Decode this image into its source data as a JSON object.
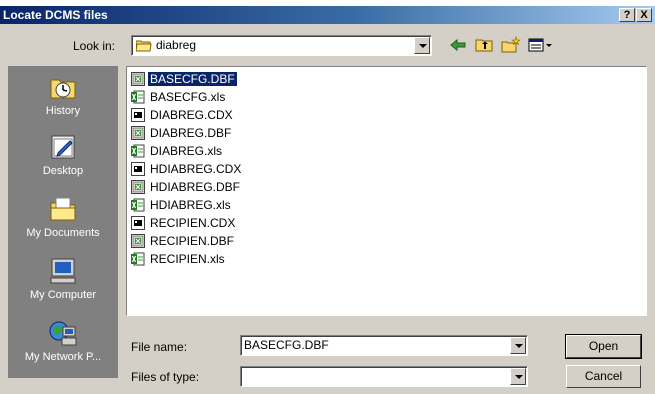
{
  "dialog": {
    "title": "Locate DCMS files",
    "help_label": "?",
    "close_label": "X"
  },
  "look_in": {
    "label": "Look in:",
    "value": "diabreg"
  },
  "places": [
    {
      "label": "History",
      "icon": "history-icon"
    },
    {
      "label": "Desktop",
      "icon": "desktop-icon"
    },
    {
      "label": "My Documents",
      "icon": "my-documents-icon"
    },
    {
      "label": "My Computer",
      "icon": "my-computer-icon"
    },
    {
      "label": "My Network P...",
      "icon": "my-network-places-icon"
    }
  ],
  "files": [
    {
      "name": "BASECFG.DBF",
      "type": "dbf",
      "selected": true
    },
    {
      "name": "BASECFG.xls",
      "type": "xls"
    },
    {
      "name": "DIABREG.CDX",
      "type": "cdx"
    },
    {
      "name": "DIABREG.DBF",
      "type": "dbf"
    },
    {
      "name": "DIABREG.xls",
      "type": "xls"
    },
    {
      "name": "HDIABREG.CDX",
      "type": "cdx"
    },
    {
      "name": "HDIABREG.DBF",
      "type": "dbf"
    },
    {
      "name": "HDIABREG.xls",
      "type": "xls"
    },
    {
      "name": "RECIPIEN.CDX",
      "type": "cdx"
    },
    {
      "name": "RECIPIEN.DBF",
      "type": "dbf"
    },
    {
      "name": "RECIPIEN.xls",
      "type": "xls"
    }
  ],
  "file_name": {
    "label": "File name:",
    "value": "BASECFG.DBF"
  },
  "file_type": {
    "label": "Files of type:",
    "value": ""
  },
  "buttons": {
    "open": "Open",
    "cancel": "Cancel"
  },
  "colors": {
    "title_bar": "#0a246a",
    "selection": "#0a246a",
    "face": "#d4d0c8",
    "places_bar": "#808080"
  }
}
